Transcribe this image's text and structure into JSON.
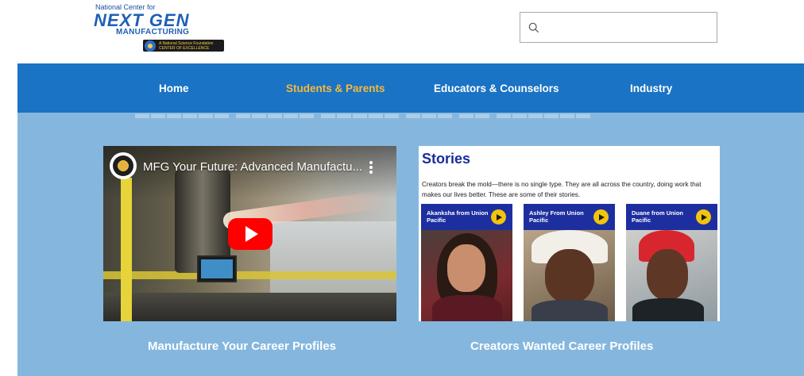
{
  "header": {
    "logo": {
      "top_line": "National Center for",
      "main": "NEXT GEN",
      "sub": "MANUFACTURING",
      "badge_line1": "A National Science Foundation",
      "badge_line2": "CENTER OF EXCELLENCE"
    },
    "search": {
      "placeholder": "",
      "value": ""
    }
  },
  "nav": {
    "items": [
      {
        "label": "Home",
        "active": false
      },
      {
        "label": "Students & Parents",
        "active": true
      },
      {
        "label": "Educators & Counselors",
        "active": false
      },
      {
        "label": "Industry",
        "active": false
      }
    ],
    "active_color": "#f5b93b",
    "bar_color": "#1a73c4"
  },
  "main": {
    "background": "#85b7de",
    "video": {
      "title": "MFG Your Future: Advanced Manufactu...",
      "play_color": "#ff0000"
    },
    "stories": {
      "title": "Stories",
      "description": "Creators break the mold—there is no single type. They are all across the country, doing work that makes our lives better. These are some of their stories.",
      "cards": [
        {
          "name": "Akanksha from Union Pacific"
        },
        {
          "name": "Ashley From Union Pacific"
        },
        {
          "name": "Duane from Union Pacific"
        }
      ]
    },
    "captions": {
      "left": "Manufacture Your Career Profiles",
      "right": "Creators Wanted Career Profiles"
    }
  }
}
